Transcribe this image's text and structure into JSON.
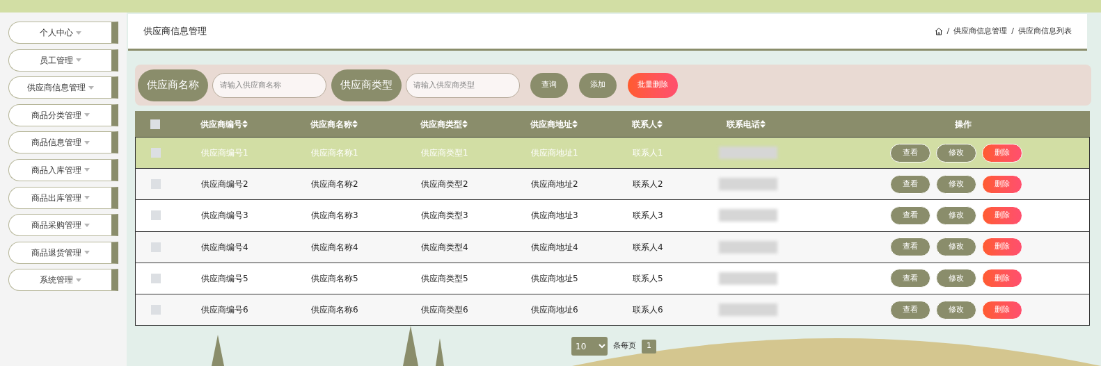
{
  "sidebar": {
    "items": [
      {
        "label": "个人中心"
      },
      {
        "label": "员工管理"
      },
      {
        "label": "供应商信息管理"
      },
      {
        "label": "商品分类管理"
      },
      {
        "label": "商品信息管理"
      },
      {
        "label": "商品入库管理"
      },
      {
        "label": "商品出库管理"
      },
      {
        "label": "商品采购管理"
      },
      {
        "label": "商品退货管理"
      },
      {
        "label": "系统管理"
      }
    ]
  },
  "header": {
    "title": "供应商信息管理",
    "breadcrumb": [
      {
        "separator": "/",
        "label": "供应商信息管理"
      },
      {
        "separator": "/",
        "label": "供应商信息列表"
      }
    ]
  },
  "search": {
    "fields": [
      {
        "label": "供应商名称",
        "placeholder": "请输入供应商名称"
      },
      {
        "label": "供应商类型",
        "placeholder": "请输入供应商类型"
      }
    ],
    "buttons": [
      {
        "label": "查询",
        "kind": "normal"
      },
      {
        "label": "添加",
        "kind": "normal"
      },
      {
        "label": "批量删除",
        "kind": "danger"
      }
    ]
  },
  "table": {
    "header_checked": false,
    "columns": [
      "供应商编号",
      "供应商名称",
      "供应商类型",
      "供应商地址",
      "联系人",
      "联系电话"
    ],
    "actions_column": "操作",
    "rows": [
      {
        "selected": true,
        "checked": false,
        "cells": [
          "供应商编号1",
          "供应商名称1",
          "供应商类型1",
          "供应商地址1",
          "联系人1"
        ],
        "actions": [
          "查看",
          "修改",
          "删除"
        ]
      },
      {
        "selected": false,
        "checked": false,
        "cells": [
          "供应商编号2",
          "供应商名称2",
          "供应商类型2",
          "供应商地址2",
          "联系人2"
        ],
        "actions": [
          "查看",
          "修改",
          "删除"
        ]
      },
      {
        "selected": false,
        "checked": false,
        "cells": [
          "供应商编号3",
          "供应商名称3",
          "供应商类型3",
          "供应商地址3",
          "联系人3"
        ],
        "actions": [
          "查看",
          "修改",
          "删除"
        ]
      },
      {
        "selected": false,
        "checked": false,
        "cells": [
          "供应商编号4",
          "供应商名称4",
          "供应商类型4",
          "供应商地址4",
          "联系人4"
        ],
        "actions": [
          "查看",
          "修改",
          "删除"
        ]
      },
      {
        "selected": false,
        "checked": false,
        "cells": [
          "供应商编号5",
          "供应商名称5",
          "供应商类型5",
          "供应商地址5",
          "联系人5"
        ],
        "actions": [
          "查看",
          "修改",
          "删除"
        ]
      },
      {
        "selected": false,
        "checked": false,
        "cells": [
          "供应商编号6",
          "供应商名称6",
          "供应商类型6",
          "供应商地址6",
          "联系人6"
        ],
        "actions": [
          "查看",
          "修改",
          "删除"
        ]
      }
    ]
  },
  "pagination": {
    "page_size": "10",
    "page_size_label": "条每页",
    "pages": [
      {
        "label": "1",
        "selected": true
      }
    ]
  }
}
